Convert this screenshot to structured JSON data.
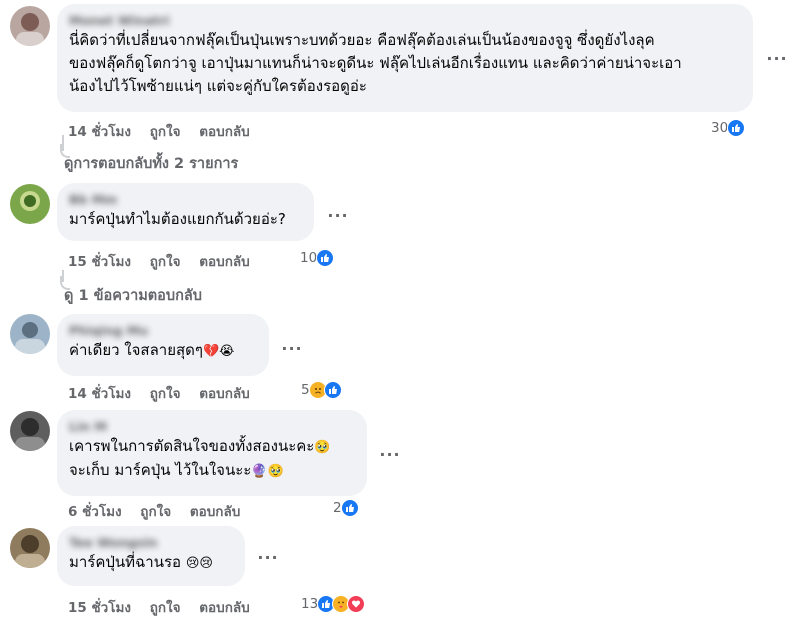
{
  "colors": {
    "like": "#1877f2",
    "meta": "#65676b",
    "bubble": "#f0f2f5",
    "heart": "#f33e58"
  },
  "comments": [
    {
      "author": "Monet Winatri",
      "text": "นี่คิดว่าที่เปลี่ยนจากฟลุ๊คเป็นปุ่นเพราะบทด้วยอะ คือฟลุ๊คต้องเล่นเป็นน้องของจูจู ซึ่งดูยังไงลุค\nของฟลุ๊คก็ดูโตกว่าจู เอาปุ่นมาแทนก็น่าจะดูดีนะ ฟลุ๊คไปเล่นอีกเรื่องแทน และคิดว่าค่ายน่าจะเอา\nน้องไปไว้โพซ้ายแน่ๆ แต่จะคู่กับใครต้องรอดูอ่ะ",
      "time": "14 ชั่วโมง",
      "like": "ถูกใจ",
      "reply": "ตอบกลับ",
      "reaction_count": "30",
      "view_replies": "ดูการตอบกลับทั้ง 2 รายการ"
    },
    {
      "author": "Bb Mm",
      "text": "มาร์คปุ่นทำไมต้องแยกกันด้วยอ่ะ?",
      "time": "15 ชั่วโมง",
      "like": "ถูกใจ",
      "reply": "ตอบกลับ",
      "reaction_count": "10",
      "view_replies": "ดู 1 ข้อความตอบกลับ"
    },
    {
      "author": "Phiqing Mu",
      "text": "ค่าเดียว ใจสลายสุดๆ",
      "text_emoji": "💔😭",
      "time": "14 ชั่วโมง",
      "like": "ถูกใจ",
      "reply": "ตอบกลับ",
      "reaction_count": "5"
    },
    {
      "author": "Lin M",
      "text": "เคารพในการตัดสินใจของทั้งสองนะคะ",
      "text2": "จะเก็บ มาร์คปุ่น ไว้ในใจนะะ",
      "text_emoji": "🥹",
      "text2_emoji": "🔮🥹",
      "time": "6 ชั่วโมง",
      "like": "ถูกใจ",
      "reply": "ตอบกลับ",
      "reaction_count": "2"
    },
    {
      "author": "Tee Wongsin",
      "text": "มาร์คปุ่นที่ฉานรอ",
      "text_emoji": "😢😢",
      "time": "15 ชั่วโมง",
      "like": "ถูกใจ",
      "reply": "ตอบกลับ",
      "reaction_count": "13"
    }
  ],
  "more_icon": "more-options-icon"
}
